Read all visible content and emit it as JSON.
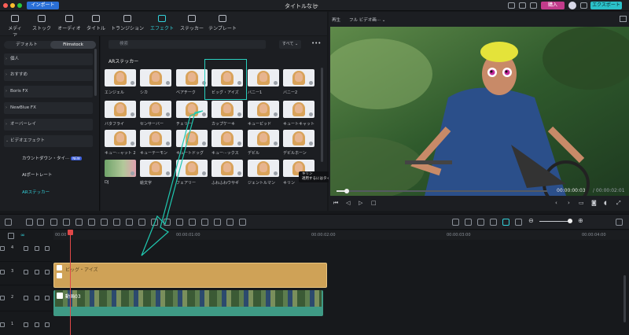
{
  "titlebar": {
    "import_label": "インポート",
    "title": "タイトルなし",
    "buy_label": "購入",
    "export_label": "エクスポート"
  },
  "toptabs": [
    {
      "label": "メディア"
    },
    {
      "label": "ストック"
    },
    {
      "label": "オーディオ"
    },
    {
      "label": "タイトル"
    },
    {
      "label": "トランジション"
    },
    {
      "label": "エフェクト"
    },
    {
      "label": "ステッカー"
    },
    {
      "label": "テンプレート"
    }
  ],
  "sidebar": {
    "seg": [
      "デフォルト",
      "Filmstock"
    ],
    "cats": [
      "個人",
      "おすすめ",
      "Boris FX",
      "NewBlue FX",
      "オーバーレイ",
      "ビデオエフェクト"
    ],
    "subs": [
      {
        "label": "カウントダウン・タイ···",
        "tag": "NEW"
      },
      {
        "label": "AIポートレート",
        "tag": ""
      },
      {
        "label": "ARステッカー",
        "tag": ""
      }
    ]
  },
  "content": {
    "search_placeholder": "検索",
    "all_label": "すべて",
    "more": "•••",
    "section_title": "ARステッカー",
    "items": [
      "エンジェル",
      "シカ",
      "ベアチーク",
      "ビッグ・アイズ",
      "バニー1",
      "バニー2",
      "バタフライ",
      "センサーバー",
      "チェリー",
      "カップケーキ",
      "キューピッド",
      "キュートキャット",
      "キュー···ャット 2",
      "キューテーモン",
      "キュートドッグ",
      "キュー···ックス",
      "デビル",
      "デビルホーン",
      "DJ",
      "絵文字",
      "フェアリー",
      "ふわふわウサギ",
      "ジェントルマン",
      "キリン"
    ],
    "tooltip_title": "キリン",
    "tooltip_text": "適用するにはタイムラインにドラッグしてください"
  },
  "preview": {
    "tab": "再生",
    "quality": "フル ビデオ画···",
    "time_current": "00:00:00:03",
    "time_total": "/ 00:00:02:01",
    "progress": 0.05
  },
  "ruler": [
    "00:00",
    "00:00:01:00",
    "00:00:02:00",
    "00:00:03:00",
    "00:00:04:00"
  ],
  "tracks": [
    "4",
    "3",
    "2",
    "1"
  ],
  "clips": {
    "ar_label": "ビッグ・アイズ",
    "video_label": "動画03"
  }
}
